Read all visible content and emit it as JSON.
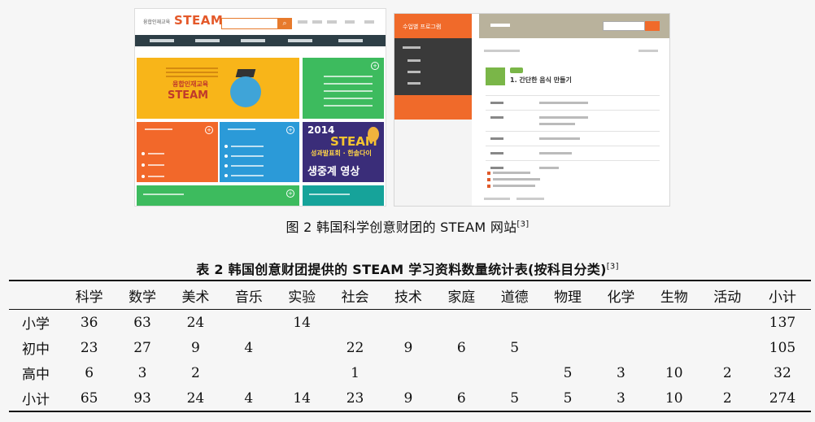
{
  "figure": {
    "portal": {
      "small_logo": "융합인재교육",
      "brand": "STEAM",
      "search_button_icon": "magnifier-icon",
      "hero_line1": "융합인재교육",
      "hero_line2": "STEAM",
      "promo_year": "2014",
      "promo_brand": "STEAM",
      "promo_line1": "성과발표회 · 한솔다이",
      "promo_line2": "생중계 영상"
    },
    "lesson_page": {
      "sidebar_title": "수업별 프로그램",
      "lesson_title": "1. 간단한 음식 만들기"
    },
    "caption_text": "图 2  韩国科学创意财团的 STEAM 网站",
    "caption_ref": "[3]"
  },
  "table_caption": {
    "text": "表 2  韩国创意财团提供的 STEAM 学习资料数量统计表(按科目分类)",
    "ref": "[3]"
  },
  "table": {
    "headers": [
      "",
      "科学",
      "数学",
      "美术",
      "音乐",
      "实验",
      "社会",
      "技术",
      "家庭",
      "道德",
      "物理",
      "化学",
      "生物",
      "活动",
      "小计"
    ],
    "rows": [
      [
        "小学",
        "36",
        "63",
        "24",
        "",
        "14",
        "",
        "",
        "",
        "",
        "",
        "",
        "",
        "",
        "137"
      ],
      [
        "初中",
        "23",
        "27",
        "9",
        "4",
        "",
        "22",
        "9",
        "6",
        "5",
        "",
        "",
        "",
        "",
        "105"
      ],
      [
        "高中",
        "6",
        "3",
        "2",
        "",
        "",
        "1",
        "",
        "",
        "",
        "5",
        "3",
        "10",
        "2",
        "32"
      ],
      [
        "小计",
        "65",
        "93",
        "24",
        "4",
        "14",
        "23",
        "9",
        "6",
        "5",
        "5",
        "3",
        "10",
        "2",
        "274"
      ]
    ]
  }
}
